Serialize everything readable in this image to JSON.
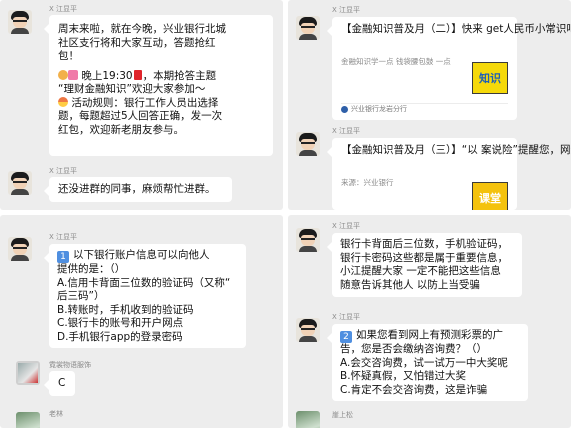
{
  "top_left": {
    "msg1": {
      "sender": "X 江显平",
      "lines": [
        "周末来啦，就在今晚，兴业银行北城",
        "社区支行将和大家互动，答题抢红",
        "包！"
      ],
      "promo_line_1": "晚上19:30",
      "promo_line_1_tail": "，本期抢答主题",
      "promo_line_2": "“理财金融知识”欢迎大家参加～",
      "rule_lines": [
        "活动规则：银行工作人员出选择",
        "题，每题超过5人回答正确，发一次",
        "红包，欢迎新老朋友参与。"
      ]
    },
    "msg2": {
      "sender": "X 江显平",
      "text": "还没进群的同事，麻烦帮忙进群。"
    }
  },
  "top_right": {
    "card1": {
      "sender": "X 江显平",
      "title_lines": [
        "【金融知识普及月（二）】快来",
        "get人民币小常识吧！"
      ],
      "desc_lines": [
        "金融知识学一点 钱袋腰包鼓",
        "一点"
      ],
      "thumb_text": "知识",
      "footer": "兴业银行龙岩分行"
    },
    "card2": {
      "sender": "X 江显平",
      "title_lines": [
        "【金融知识普及月（三）】“以",
        "案说险”提醒您，网络诈骗需..."
      ],
      "desc_lines": [
        "来源：兴业银行"
      ],
      "thumb_text": "课堂"
    }
  },
  "bottom_left": {
    "question": {
      "sender": "X 江显平",
      "num": "1",
      "lines": [
        "以下银行账户信息可以向他人",
        "提供的是：（）",
        "A.信用卡背面三位数的验证码（又称“",
        "后三码”）",
        "B.转账时，手机收到的验证码",
        "C.银行卡的账号和开户网点",
        "D.手机银行app的登录密码"
      ]
    },
    "answer": {
      "sender": "霓裳物语服饰",
      "text": "C"
    },
    "next_sender": "老林"
  },
  "bottom_right": {
    "msg1": {
      "sender": "X 江显平",
      "lines": [
        "银行卡背面后三位数，手机验证码，",
        "银行卡密码这些都是属于重要信息，",
        "小江提醒大家 一定不能把这些信息",
        "随意告诉其他人 以防上当受骗"
      ]
    },
    "msg2": {
      "sender": "X 江显平",
      "num": "2",
      "lines": [
        "如果您看到网上有预测彩票的广",
        "告，您是否会缴纳咨询费？（）",
        "A.会交咨询费，试一试万一中大奖呢",
        "B.怀疑真假，又怕错过大奖",
        "C.肯定不会交咨询费，这是诈骗"
      ]
    },
    "next_sender": "崖上松"
  }
}
